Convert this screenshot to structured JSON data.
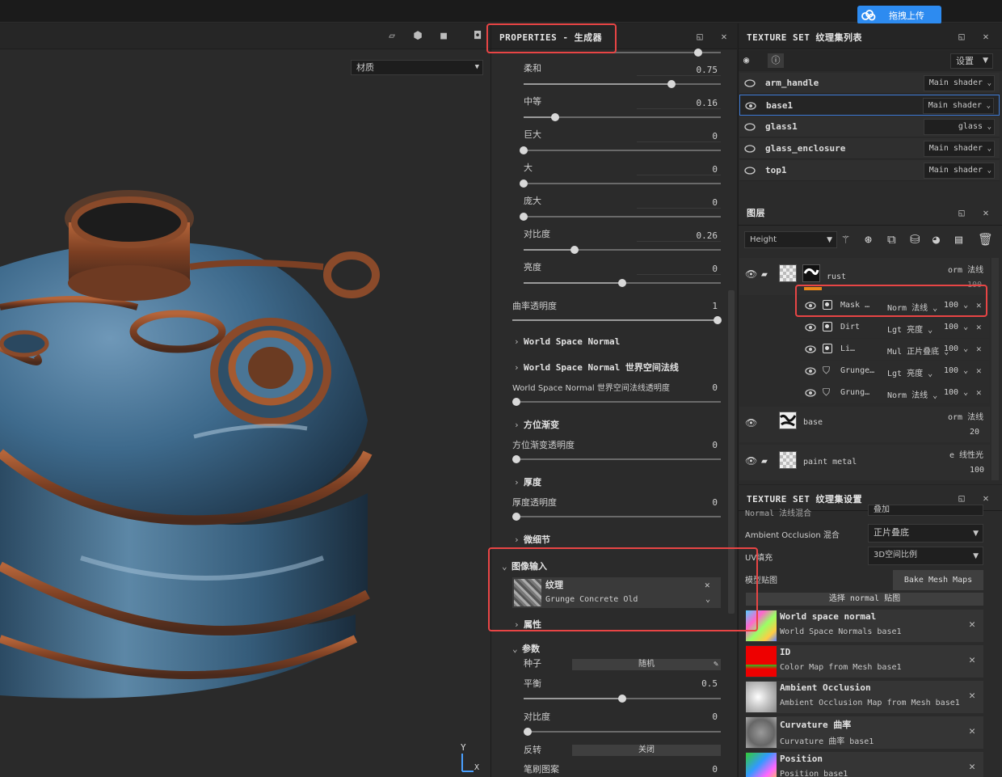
{
  "upload": {
    "label": "拖拽上传"
  },
  "viewport": {
    "material_select": "材质",
    "axis_y": "Y",
    "axis_x": "X"
  },
  "properties": {
    "title": "PROPERTIES - 生成器",
    "sliders": [
      {
        "label": "柔和",
        "value": "0.75",
        "fraction": 0.75
      },
      {
        "label": "中等",
        "value": "0.16",
        "fraction": 0.16
      },
      {
        "label": "巨大",
        "value": "0",
        "fraction": 0
      },
      {
        "label": "大",
        "value": "0",
        "fraction": 0
      },
      {
        "label": "庞大",
        "value": "0",
        "fraction": 0
      },
      {
        "label": "对比度",
        "value": "0.26",
        "fraction": 0.26
      },
      {
        "label": "亮度",
        "value": "0",
        "fraction": 0.5
      }
    ],
    "curvature_opacity": {
      "label": "曲率透明度",
      "value": "1",
      "fraction": 1
    },
    "sec_wsn1": "World Space Normal",
    "sec_wsn2": "World Space Normal 世界空间法线",
    "wsn_opacity": {
      "label": "World Space Normal 世界空间法线透明度",
      "value": "0",
      "fraction": 0
    },
    "sec_dir": "方位渐变",
    "dir_opacity": {
      "label": "方位渐变透明度",
      "value": "0",
      "fraction": 0
    },
    "sec_thick": "厚度",
    "thick_opacity": {
      "label": "厚度透明度",
      "value": "0",
      "fraction": 0
    },
    "sec_detail": "微细节",
    "sec_image": "图像输入",
    "texture": {
      "title": "纹理",
      "name": "Grunge Concrete Old"
    },
    "sec_attr": "属性",
    "sec_params": "参数",
    "seed": {
      "label": "种子",
      "value": "随机"
    },
    "balance": {
      "label": "平衡",
      "value": "0.5",
      "fraction": 0.5
    },
    "contrast2": {
      "label": "对比度",
      "value": "0",
      "fraction": 0
    },
    "invert": {
      "label": "反转",
      "value": "关闭"
    },
    "brush_pattern": {
      "label": "笔刷图案",
      "value": "0"
    }
  },
  "texture_set_list": {
    "title": "TEXTURE SET 纹理集列表",
    "settings_label": "设置",
    "items": [
      {
        "name": "arm_handle",
        "shader": "Main shader"
      },
      {
        "name": "base1",
        "shader": "Main shader"
      },
      {
        "name": "glass1",
        "shader": "glass"
      },
      {
        "name": "glass_enclosure",
        "shader": "Main shader"
      },
      {
        "name": "top1",
        "shader": "Main shader"
      }
    ]
  },
  "layers": {
    "title": "图层",
    "channel": "Height",
    "rust": {
      "name": "rust",
      "blend": "orm 法线",
      "opacity": "100"
    },
    "sublayers": [
      {
        "name": "Mask …",
        "blend": "Norm 法线",
        "opacity": "100"
      },
      {
        "name": "Dirt",
        "blend": "Lgt 亮度",
        "opacity": "100"
      },
      {
        "name": "Li…",
        "blend": "Mul 正片叠底",
        "opacity": "100"
      },
      {
        "name": "Grunge…",
        "blend": "Lgt 亮度",
        "opacity": "100"
      },
      {
        "name": "Grung…",
        "blend": "Norm 法线",
        "opacity": "100"
      }
    ],
    "base": {
      "name": "base",
      "blend": "orm 法线",
      "opacity": "20"
    },
    "paint": {
      "name": "paint metal",
      "blend": "e 线性光",
      "opacity": "100"
    }
  },
  "texture_set_settings": {
    "title": "TEXTURE SET 纹理集设置",
    "normal_cut": "Normal 法线混合",
    "normal_cut_val": "叠加",
    "ao_label": "Ambient Occlusion 混合",
    "ao_value": "正片叠底",
    "uv_label": "UV填充",
    "uv_value": "3D空间比例",
    "mesh_maps_label": "模型贴图",
    "bake_button": "Bake Mesh Maps",
    "select_normal": "选择 normal 贴图",
    "maps": [
      {
        "name": "World space normal",
        "sub": "World Space Normals base1"
      },
      {
        "name": "ID",
        "sub": "Color Map from Mesh base1"
      },
      {
        "name": "Ambient Occlusion",
        "sub": "Ambient Occlusion Map from Mesh base1"
      },
      {
        "name": "Curvature 曲率",
        "sub": "Curvature 曲率 base1"
      },
      {
        "name": "Position",
        "sub": "Position base1"
      }
    ]
  }
}
